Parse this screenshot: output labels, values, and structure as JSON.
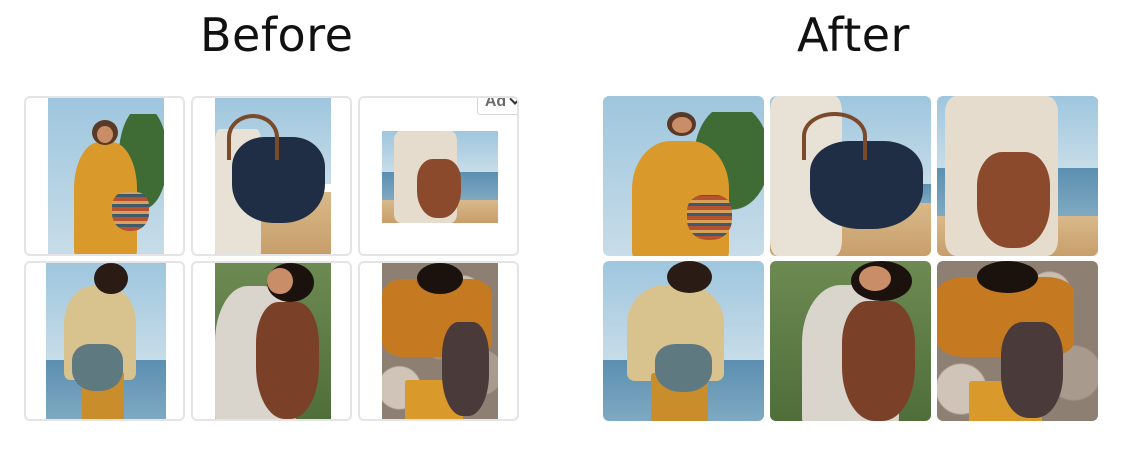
{
  "headings": {
    "before": "Before",
    "after": "After"
  },
  "ad_badge": {
    "label": "Ad",
    "icon": "chevron-down-icon"
  },
  "panels": [
    {
      "id": "before",
      "layout": "letterboxed"
    },
    {
      "id": "after",
      "layout": "full-bleed"
    }
  ],
  "colors": {
    "border": "#e4e4e4",
    "badge_text": "#6b6b6b",
    "heading": "#111111"
  }
}
